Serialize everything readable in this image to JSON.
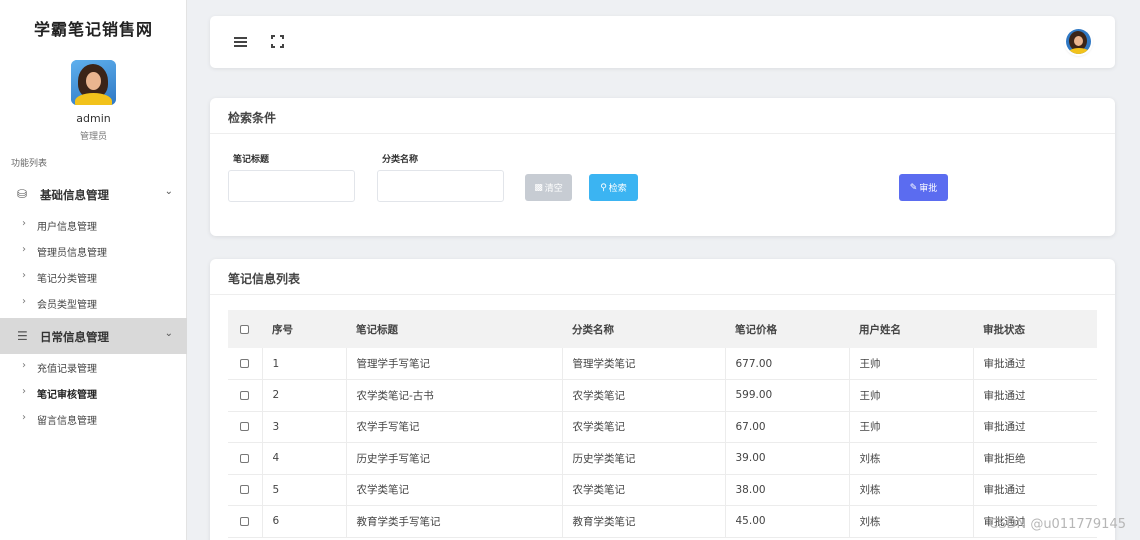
{
  "sidebar": {
    "brand": "学霸笔记销售网",
    "user_name": "admin",
    "user_role": "管理员",
    "menu_caption": "功能列表",
    "groups": [
      {
        "label": "基础信息管理",
        "icon": "database-icon",
        "items": [
          {
            "label": "用户信息管理"
          },
          {
            "label": "管理员信息管理"
          },
          {
            "label": "笔记分类管理"
          },
          {
            "label": "会员类型管理"
          }
        ]
      },
      {
        "label": "日常信息管理",
        "icon": "server-icon",
        "items": [
          {
            "label": "充值记录管理"
          },
          {
            "label": "笔记审核管理"
          },
          {
            "label": "留言信息管理"
          }
        ]
      }
    ]
  },
  "search": {
    "title": "检索条件",
    "title_label": "笔记标题",
    "title_value": "",
    "category_label": "分类名称",
    "category_value": "",
    "clear_label": "清空",
    "search_label": "检索",
    "approve_label": "审批"
  },
  "list": {
    "title": "笔记信息列表",
    "columns": [
      "序号",
      "笔记标题",
      "分类名称",
      "笔记价格",
      "用户姓名",
      "审批状态"
    ],
    "rows": [
      [
        "1",
        "管理学手写笔记",
        "管理学类笔记",
        "677.00",
        "王帅",
        "审批通过"
      ],
      [
        "2",
        "农学类笔记-古书",
        "农学类笔记",
        "599.00",
        "王帅",
        "审批通过"
      ],
      [
        "3",
        "农学手写笔记",
        "农学类笔记",
        "67.00",
        "王帅",
        "审批通过"
      ],
      [
        "4",
        "历史学手写笔记",
        "历史学类笔记",
        "39.00",
        "刘栋",
        "审批拒绝"
      ],
      [
        "5",
        "农学类笔记",
        "农学类笔记",
        "38.00",
        "刘栋",
        "审批通过"
      ],
      [
        "6",
        "教育学类手写笔记",
        "教育学类笔记",
        "45.00",
        "刘栋",
        "审批通过"
      ]
    ]
  },
  "watermark": "CSDN @u011779145",
  "colors": {
    "approve": "#5b6cf0",
    "search": "#3bb4f2",
    "clear": "#c7ccd3",
    "active_group": "#d9d9d9"
  }
}
